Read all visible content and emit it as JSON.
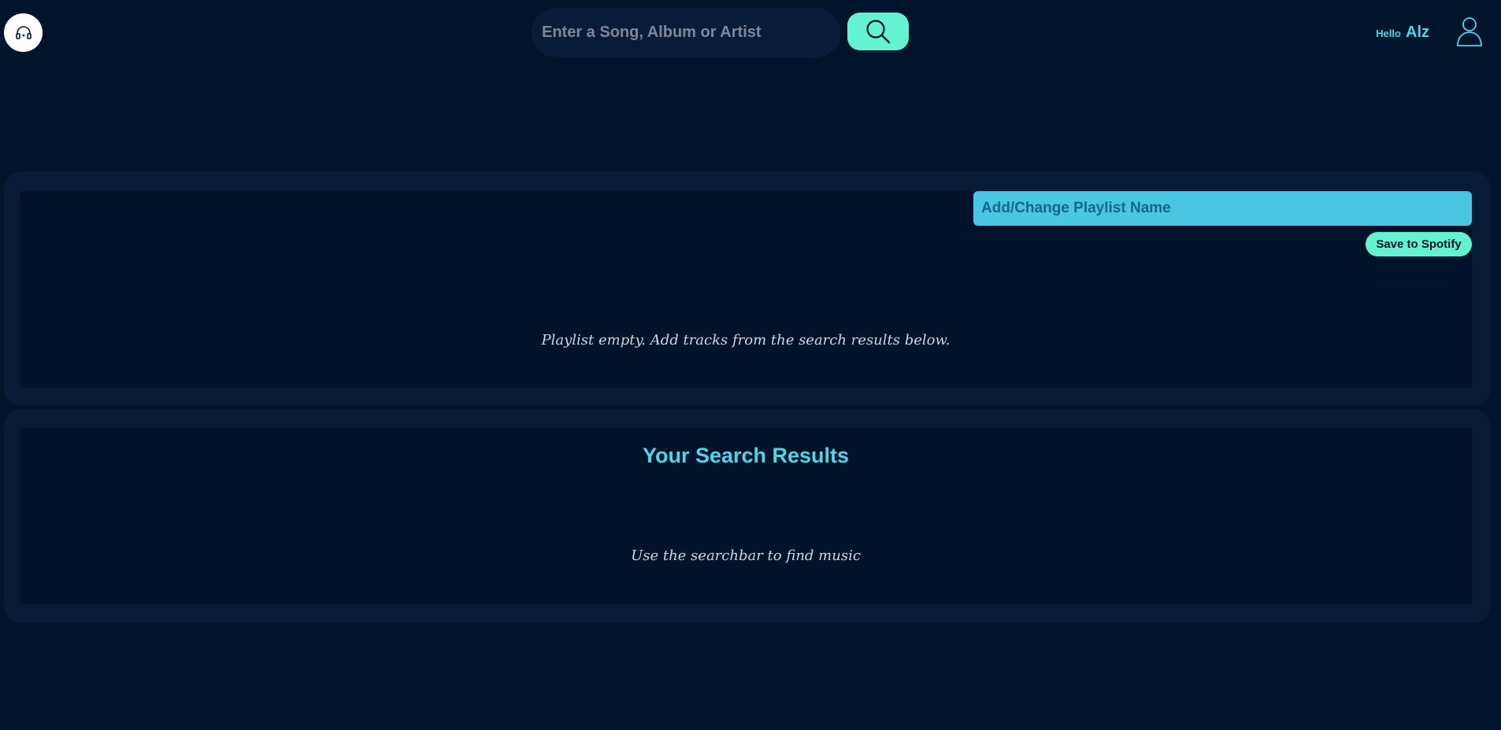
{
  "header": {
    "logo_icon": "headphones-icon",
    "search": {
      "placeholder": "Enter a Song, Album or Artist",
      "value": "",
      "button_icon": "search-icon"
    },
    "greeting_prefix": "Hello",
    "user_name": "Alz",
    "user_icon": "user-icon"
  },
  "playlist": {
    "name_placeholder": "Add/Change Playlist Name",
    "name_value": "",
    "save_label": "Save to Spotify",
    "empty_message": "Playlist empty. Add tracks from the search results below."
  },
  "results": {
    "title": "Your Search Results",
    "empty_message": "Use the searchbar to find music"
  },
  "colors": {
    "background": "#00142b",
    "panel": "#071a36",
    "accent": "#64f3d0",
    "heading": "#4dd6e8",
    "input_bg": "#48c6e2"
  }
}
